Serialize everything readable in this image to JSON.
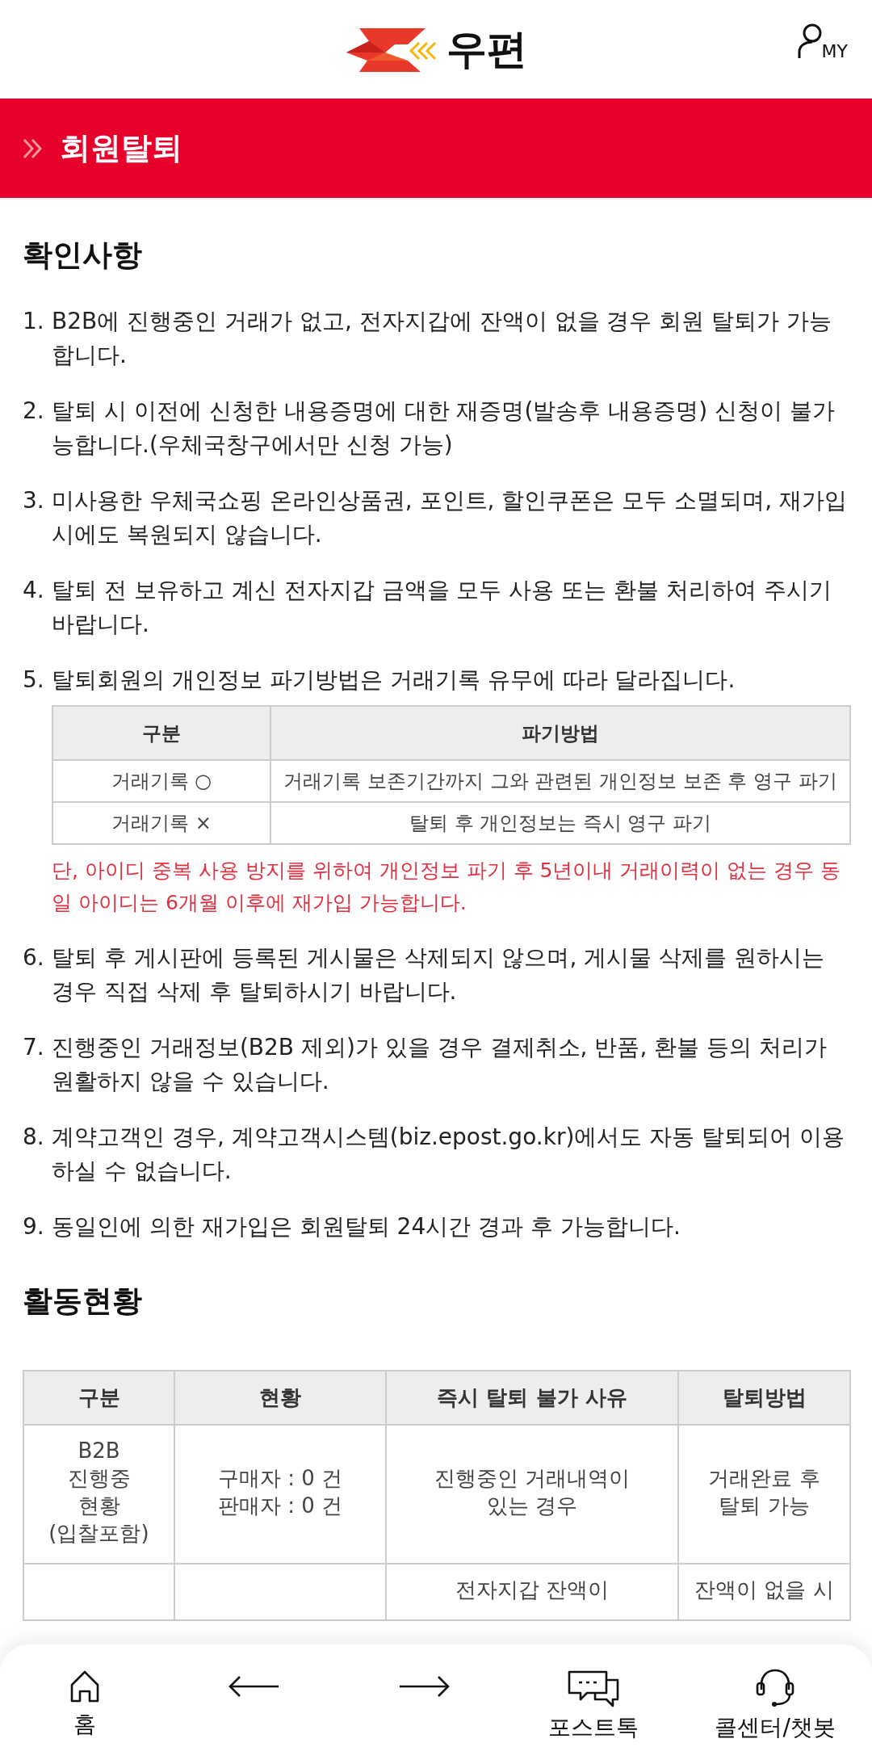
{
  "header": {
    "logo_text": "우편",
    "my_label": "MY"
  },
  "title_bar": {
    "title": "회원탈퇴"
  },
  "notice": {
    "heading": "확인사항",
    "items": [
      {
        "number": "1.",
        "text": "B2B에 진행중인 거래가 없고, 전자지갑에 잔액이 없을 경우 회원 탈퇴가 가능합니다."
      },
      {
        "number": "2.",
        "text": "탈퇴 시 이전에 신청한 내용증명에 대한 재증명(발송후 내용증명) 신청이 불가능합니다.(우체국창구에서만 신청 가능)"
      },
      {
        "number": "3.",
        "text": "미사용한 우체국쇼핑 온라인상품권, 포인트, 할인쿠폰은 모두 소멸되며, 재가입 시에도 복원되지 않습니다."
      },
      {
        "number": "4.",
        "text": "탈퇴 전 보유하고 계신 전자지갑 금액을 모두 사용 또는 환불 처리하여 주시기 바랍니다."
      },
      {
        "number": "5.",
        "text": "탈퇴회원의 개인정보 파기방법은 거래기록 유무에 따라 달라집니다.",
        "table": {
          "columns": [
            "구분",
            "파기방법"
          ],
          "rows": [
            [
              "거래기록 ○",
              "거래기록 보존기간까지 그와 관련된 개인정보 보존 후 영구 파기"
            ],
            [
              "거래기록 ×",
              "탈퇴 후 개인정보는 즉시 영구 파기"
            ]
          ]
        },
        "note": "단, 아이디 중복 사용 방지를 위하여 개인정보 파기 후 5년이내 거래이력이 없는 경우 동일 아이디는 6개월 이후에 재가입 가능합니다."
      },
      {
        "number": "6.",
        "text": "탈퇴 후 게시판에 등록된 게시물은 삭제되지 않으며, 게시물 삭제를 원하시는 경우 직접 삭제 후 탈퇴하시기 바랍니다."
      },
      {
        "number": "7.",
        "text": "진행중인 거래정보(B2B 제외)가 있을 경우 결제취소, 반품, 환불 등의 처리가 원활하지 않을 수 있습니다."
      },
      {
        "number": "8.",
        "text": "계약고객인 경우, 계약고객시스템(biz.epost.go.kr)에서도 자동 탈퇴되어 이용하실 수 없습니다."
      },
      {
        "number": "9.",
        "text": "동일인에 의한 재가입은 회원탈퇴 24시간 경과 후 가능합니다."
      }
    ]
  },
  "activity": {
    "heading": "활동현황",
    "table": {
      "columns": [
        "구분",
        "현황",
        "즉시 탈퇴 불가 사유",
        "탈퇴방법"
      ],
      "rows": [
        [
          "B2B\n진행중\n현황\n(입찰포함)",
          "구매자 : 0 건\n판매자 : 0 건",
          "진행중인 거래내역이\n있는 경우",
          "거래완료 후\n탈퇴 가능"
        ],
        [
          "",
          "",
          "전자지갑 잔액이",
          "잔액이 없을 시"
        ]
      ]
    }
  },
  "bottom_nav": [
    {
      "kind": "home",
      "label": "홈"
    },
    {
      "kind": "back"
    },
    {
      "kind": "forward"
    },
    {
      "kind": "chat",
      "label": "포스트톡"
    },
    {
      "kind": "headset",
      "label": "콜센터/챗봇"
    }
  ]
}
